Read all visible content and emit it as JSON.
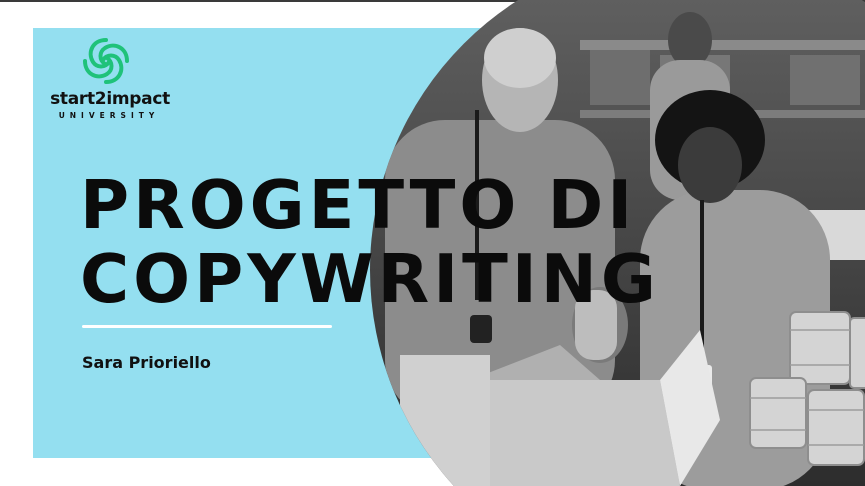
{
  "brand": {
    "name": "start2impact",
    "subtitle": "UNIVERSITY",
    "logo_icon": "leaf-swirl-logo-icon",
    "logo_color": "#1fc27a"
  },
  "slide": {
    "title": "PROGETTO DI\nCOPYWRITING",
    "author": "Sara Prioriello"
  },
  "colors": {
    "panel": "#94dff0",
    "divider": "#ffffff",
    "text": "#0b0b0b"
  },
  "photo": {
    "description_icon": "volunteers-packing-boxes-photo"
  }
}
